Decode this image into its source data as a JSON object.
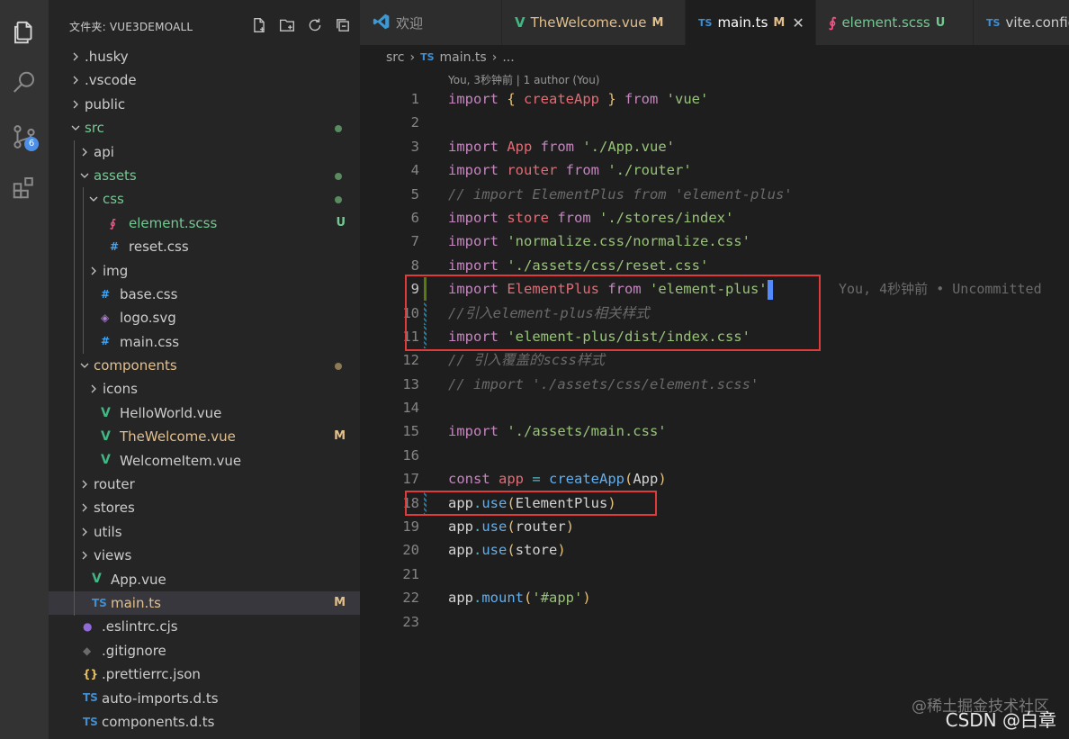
{
  "explorer": {
    "title": "文件夹: VUE3DEMOALL",
    "actions": [
      "new-file-icon",
      "new-folder-icon",
      "refresh-icon",
      "collapse-all-icon"
    ],
    "items": [
      {
        "label": ".husky",
        "depth": 0,
        "kind": "folder",
        "open": false,
        "color": "#cccccc"
      },
      {
        "label": ".vscode",
        "depth": 0,
        "kind": "folder",
        "open": false,
        "color": "#cccccc"
      },
      {
        "label": "public",
        "depth": 0,
        "kind": "folder",
        "open": false,
        "color": "#cccccc"
      },
      {
        "label": "src",
        "depth": 0,
        "kind": "folder",
        "open": true,
        "color": "#73c991",
        "dot": "#5a8a5f"
      },
      {
        "label": "api",
        "depth": 1,
        "kind": "folder",
        "open": false,
        "color": "#cccccc"
      },
      {
        "label": "assets",
        "depth": 1,
        "kind": "folder",
        "open": true,
        "color": "#73c991",
        "dot": "#5a8a5f"
      },
      {
        "label": "css",
        "depth": 2,
        "kind": "folder",
        "open": true,
        "color": "#73c991",
        "dot": "#5a8a5f"
      },
      {
        "label": "element.scss",
        "depth": 3,
        "kind": "scss",
        "icon": "∮",
        "iconColor": "#f55385",
        "color": "#73c991",
        "status": "U",
        "statusColor": "#73c991"
      },
      {
        "label": "reset.css",
        "depth": 3,
        "kind": "css",
        "icon": "#",
        "iconColor": "#42a5f5",
        "color": "#cccccc"
      },
      {
        "label": "img",
        "depth": 2,
        "kind": "folder",
        "open": false,
        "color": "#cccccc"
      },
      {
        "label": "base.css",
        "depth": 2,
        "kind": "css",
        "icon": "#",
        "iconColor": "#42a5f5",
        "color": "#cccccc"
      },
      {
        "label": "logo.svg",
        "depth": 2,
        "kind": "svg",
        "icon": "◈",
        "iconColor": "#b07cd8",
        "color": "#cccccc"
      },
      {
        "label": "main.css",
        "depth": 2,
        "kind": "css",
        "icon": "#",
        "iconColor": "#42a5f5",
        "color": "#cccccc"
      },
      {
        "label": "components",
        "depth": 1,
        "kind": "folder",
        "open": true,
        "color": "#e2c08d",
        "dot": "#8c7a55"
      },
      {
        "label": "icons",
        "depth": 2,
        "kind": "folder",
        "open": false,
        "color": "#cccccc"
      },
      {
        "label": "HelloWorld.vue",
        "depth": 2,
        "kind": "vue",
        "icon": "V",
        "iconColor": "#41b883",
        "color": "#cccccc"
      },
      {
        "label": "TheWelcome.vue",
        "depth": 2,
        "kind": "vue",
        "icon": "V",
        "iconColor": "#41b883",
        "color": "#e2c08d",
        "status": "M",
        "statusColor": "#e2c08d"
      },
      {
        "label": "WelcomeItem.vue",
        "depth": 2,
        "kind": "vue",
        "icon": "V",
        "iconColor": "#41b883",
        "color": "#cccccc"
      },
      {
        "label": "router",
        "depth": 1,
        "kind": "folder",
        "open": false,
        "color": "#cccccc"
      },
      {
        "label": "stores",
        "depth": 1,
        "kind": "folder",
        "open": false,
        "color": "#cccccc"
      },
      {
        "label": "utils",
        "depth": 1,
        "kind": "folder",
        "open": false,
        "color": "#cccccc"
      },
      {
        "label": "views",
        "depth": 1,
        "kind": "folder",
        "open": false,
        "color": "#cccccc"
      },
      {
        "label": "App.vue",
        "depth": 1,
        "kind": "vue",
        "icon": "V",
        "iconColor": "#41b883",
        "color": "#cccccc"
      },
      {
        "label": "main.ts",
        "depth": 1,
        "kind": "ts",
        "icon": "TS",
        "iconColor": "#3f8fd2",
        "color": "#e2c08d",
        "status": "M",
        "statusColor": "#e2c08d",
        "active": true
      },
      {
        "label": ".eslintrc.cjs",
        "depth": 0,
        "kind": "eslint",
        "icon": "●",
        "iconColor": "#8f6ad8",
        "color": "#cccccc"
      },
      {
        "label": ".gitignore",
        "depth": 0,
        "kind": "git",
        "icon": "◆",
        "iconColor": "#6b6b6b",
        "color": "#cccccc"
      },
      {
        "label": ".prettierrc.json",
        "depth": 0,
        "kind": "json",
        "icon": "{}",
        "iconColor": "#e9c46a",
        "color": "#cccccc"
      },
      {
        "label": "auto-imports.d.ts",
        "depth": 0,
        "kind": "ts",
        "icon": "TS",
        "iconColor": "#3f8fd2",
        "color": "#cccccc"
      },
      {
        "label": "components.d.ts",
        "depth": 0,
        "kind": "ts",
        "icon": "TS",
        "iconColor": "#3f8fd2",
        "color": "#cccccc"
      }
    ]
  },
  "activity": {
    "scm_badge": "6"
  },
  "tabs": [
    {
      "label": "欢迎",
      "icon": "vscode-icon",
      "iconText": "",
      "iconColor": "#3c99d4",
      "status": "",
      "close": false,
      "active": false
    },
    {
      "label": "TheWelcome.vue",
      "icon": "vue-icon",
      "iconText": "V",
      "iconColor": "#41b883",
      "status": "M",
      "statusColor": "#e2c08d",
      "close": false,
      "active": false,
      "labelColor": "#e2c08d"
    },
    {
      "label": "main.ts",
      "icon": "ts-icon",
      "iconText": "TS",
      "iconColor": "#3f8fd2",
      "status": "M",
      "statusColor": "#e2c08d",
      "close": true,
      "active": true,
      "labelColor": "#e2c08d"
    },
    {
      "label": "element.scss",
      "icon": "scss-icon",
      "iconText": "∮",
      "iconColor": "#f55385",
      "status": "U",
      "statusColor": "#73c991",
      "close": false,
      "active": false,
      "labelColor": "#73c991"
    },
    {
      "label": "vite.config",
      "icon": "ts-icon",
      "iconText": "TS",
      "iconColor": "#3f8fd2",
      "status": "",
      "close": false,
      "active": false,
      "labelColor": "#cccccc"
    }
  ],
  "breadcrumb": {
    "folder": "src",
    "file_icon": "TS",
    "file": "main.ts",
    "more": "..."
  },
  "codelens": "You, 3秒钟前 | 1 author (You)",
  "code": [
    {
      "n": "1",
      "t": [
        [
          "kw",
          "import "
        ],
        [
          "br",
          "{ "
        ],
        [
          "id",
          "createApp"
        ],
        [
          "br",
          " }"
        ],
        [
          "kw",
          " from "
        ],
        [
          "str",
          "'vue'"
        ]
      ]
    },
    {
      "n": "2",
      "t": []
    },
    {
      "n": "3",
      "t": [
        [
          "kw",
          "import "
        ],
        [
          "id",
          "App"
        ],
        [
          "kw",
          " from "
        ],
        [
          "str",
          "'./App.vue'"
        ]
      ]
    },
    {
      "n": "4",
      "t": [
        [
          "kw",
          "import "
        ],
        [
          "id",
          "router"
        ],
        [
          "kw",
          " from "
        ],
        [
          "str",
          "'./router'"
        ]
      ]
    },
    {
      "n": "5",
      "t": [
        [
          "cm",
          "// import ElementPlus from 'element-plus'"
        ]
      ]
    },
    {
      "n": "6",
      "t": [
        [
          "kw",
          "import "
        ],
        [
          "id",
          "store"
        ],
        [
          "kw",
          " from "
        ],
        [
          "str",
          "'./stores/index'"
        ]
      ]
    },
    {
      "n": "7",
      "t": [
        [
          "kw",
          "import "
        ],
        [
          "str",
          "'normalize.css/normalize.css'"
        ]
      ]
    },
    {
      "n": "8",
      "t": [
        [
          "kw",
          "import "
        ],
        [
          "str",
          "'./assets/css/reset.css'"
        ]
      ]
    },
    {
      "n": "9",
      "t": [
        [
          "kw",
          "import "
        ],
        [
          "id",
          "ElementPlus"
        ],
        [
          "kw",
          " from "
        ],
        [
          "str",
          "'element-plus'"
        ]
      ],
      "cursor": true,
      "gutter": "add",
      "blame": "You, 4秒钟前 • Uncommitted",
      "current": true
    },
    {
      "n": "10",
      "t": [
        [
          "cm",
          "//引入element-plus相关样式"
        ]
      ],
      "gutter": "mod"
    },
    {
      "n": "11",
      "t": [
        [
          "kw",
          "import "
        ],
        [
          "str",
          "'element-plus/dist/index.css'"
        ]
      ],
      "gutter": "mod"
    },
    {
      "n": "12",
      "t": [
        [
          "cm",
          "// 引入覆盖的scss样式"
        ]
      ]
    },
    {
      "n": "13",
      "t": [
        [
          "cm",
          "// import './assets/css/element.scss'"
        ]
      ]
    },
    {
      "n": "14",
      "t": []
    },
    {
      "n": "15",
      "t": [
        [
          "kw",
          "import "
        ],
        [
          "str",
          "'./assets/main.css'"
        ]
      ]
    },
    {
      "n": "16",
      "t": []
    },
    {
      "n": "17",
      "t": [
        [
          "kw",
          "const "
        ],
        [
          "id",
          "app"
        ],
        [
          "op",
          " = "
        ],
        [
          "fn",
          "createApp"
        ],
        [
          "br",
          "("
        ],
        [
          "pl",
          "App"
        ],
        [
          "br",
          ")"
        ]
      ]
    },
    {
      "n": "18",
      "t": [
        [
          "pl",
          "app"
        ],
        [
          "op",
          "."
        ],
        [
          "fn",
          "use"
        ],
        [
          "br",
          "("
        ],
        [
          "pl",
          "ElementPlus"
        ],
        [
          "br",
          ")"
        ]
      ],
      "gutter": "mod"
    },
    {
      "n": "19",
      "t": [
        [
          "pl",
          "app"
        ],
        [
          "op",
          "."
        ],
        [
          "fn",
          "use"
        ],
        [
          "br",
          "("
        ],
        [
          "pl",
          "router"
        ],
        [
          "br",
          ")"
        ]
      ]
    },
    {
      "n": "20",
      "t": [
        [
          "pl",
          "app"
        ],
        [
          "op",
          "."
        ],
        [
          "fn",
          "use"
        ],
        [
          "br",
          "("
        ],
        [
          "pl",
          "store"
        ],
        [
          "br",
          ")"
        ]
      ]
    },
    {
      "n": "21",
      "t": []
    },
    {
      "n": "22",
      "t": [
        [
          "pl",
          "app"
        ],
        [
          "op",
          "."
        ],
        [
          "fn",
          "mount"
        ],
        [
          "br",
          "("
        ],
        [
          "str",
          "'#app'"
        ],
        [
          "br",
          ")"
        ]
      ]
    },
    {
      "n": "23",
      "t": []
    }
  ],
  "watermark": {
    "top": "@稀土掘金技术社区",
    "bottom": "CSDN @白章"
  }
}
